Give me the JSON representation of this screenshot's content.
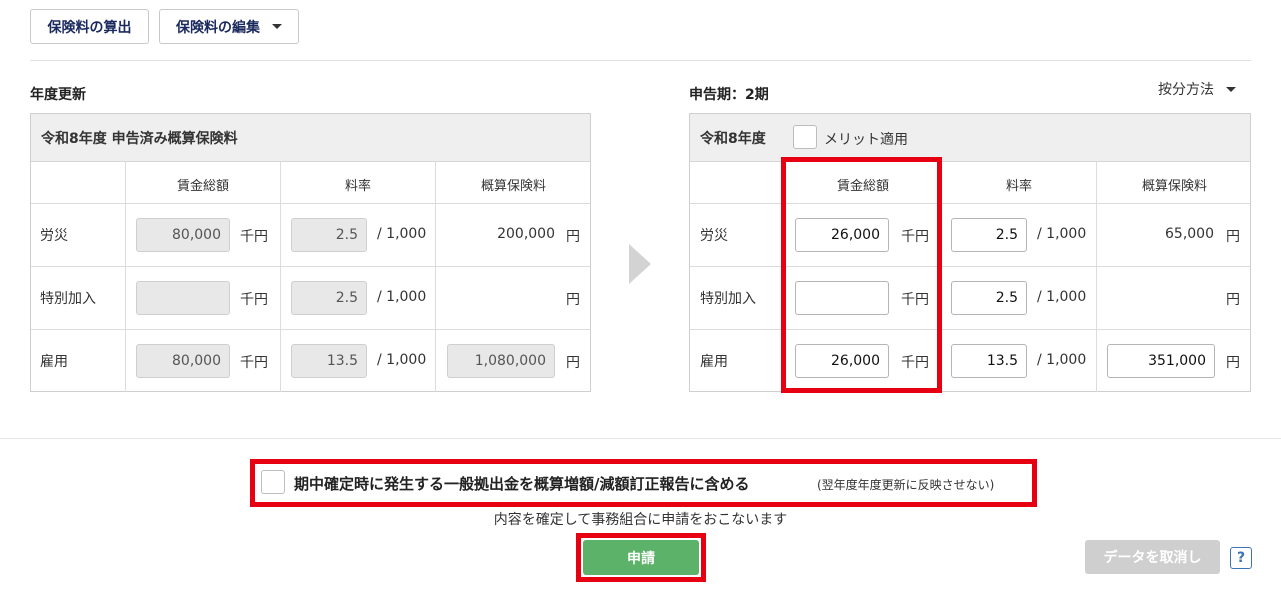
{
  "toolbar": {
    "calc_label": "保険料の算出",
    "edit_label": "保険料の編集"
  },
  "left": {
    "section_title": "年度更新",
    "table_title": "令和8年度 申告済み概算保険料",
    "columns": [
      "賃金総額",
      "料率",
      "概算保険料"
    ],
    "rows": [
      {
        "label": "労災",
        "wage": "80,000",
        "wage_unit": "千円",
        "rate": "2.5",
        "rate_unit": "/ 1,000",
        "premium": "200,000",
        "premium_unit": "円"
      },
      {
        "label": "特別加入",
        "wage": "",
        "wage_unit": "千円",
        "rate": "2.5",
        "rate_unit": "/ 1,000",
        "premium": "",
        "premium_unit": "円"
      },
      {
        "label": "雇用",
        "wage": "80,000",
        "wage_unit": "千円",
        "rate": "13.5",
        "rate_unit": "/ 1,000",
        "premium": "1,080,000",
        "premium_unit": "円"
      }
    ]
  },
  "right": {
    "section_title": "申告期：2期",
    "allocation_label": "按分方法",
    "table_title": "令和8年度",
    "merit_label": "メリット適用",
    "columns": [
      "賃金総額",
      "料率",
      "概算保険料"
    ],
    "rows": [
      {
        "label": "労災",
        "wage": "26,000",
        "wage_unit": "千円",
        "rate": "2.5",
        "rate_unit": "/ 1,000",
        "premium": "65,000",
        "premium_unit": "円"
      },
      {
        "label": "特別加入",
        "wage": "",
        "wage_unit": "千円",
        "rate": "2.5",
        "rate_unit": "/ 1,000",
        "premium": "",
        "premium_unit": "円"
      },
      {
        "label": "雇用",
        "wage": "26,000",
        "wage_unit": "千円",
        "rate": "13.5",
        "rate_unit": "/ 1,000",
        "premium": "351,000",
        "premium_unit": "円"
      }
    ]
  },
  "footer": {
    "include_label": "期中確定時に発生する一般拠出金を概算増額/減額訂正報告に含める",
    "include_note": "(翌年度年度更新に反映させない)",
    "confirm_text": "内容を確定して事務組合に申請をおこないます",
    "apply_label": "申請",
    "cancel_label": "データを取消し",
    "help_label": "?"
  },
  "colors": {
    "highlight": "#e60012",
    "apply": "#5cb268",
    "link_blue": "#1b2a5e"
  }
}
